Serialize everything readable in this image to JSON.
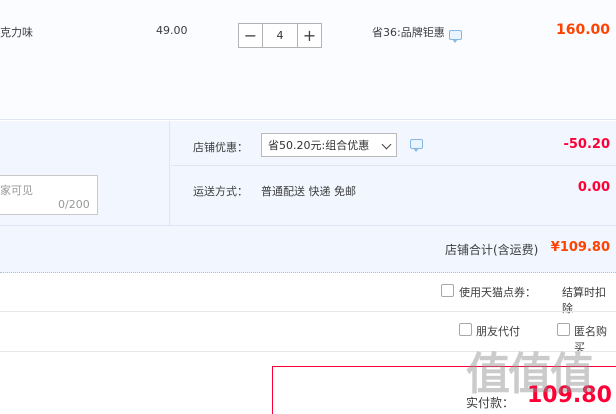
{
  "product": {
    "name": "克力味",
    "unit_price": "49.00",
    "quantity": "4",
    "decrease_label": "−",
    "increase_label": "+",
    "promotion": "省36:品牌钜惠",
    "line_total": "160.00"
  },
  "shop": {
    "discount_label": "店铺优惠：",
    "discount_selected": "省50.20元:组合优惠",
    "discount_value": "-50.20",
    "shipping_label": "运送方式：",
    "shipping_method": "普通配送 快递 免邮",
    "shipping_fee": "0.00",
    "message_placeholder": "家可见",
    "message_count": "0/200",
    "total_label": "店铺合计(含运费)",
    "total_value": "¥109.80"
  },
  "options": {
    "tmall_points_label": "使用天猫点券：",
    "checkout_deduct": "结算时扣除",
    "friend_pay_label": "朋友代付",
    "anonymous_label": "匿名购买"
  },
  "payment": {
    "label": "实付款：",
    "amount": "109.80"
  },
  "watermark": {
    "text": "值值值"
  },
  "colors": {
    "price_orange": "#ff4200",
    "price_red": "#ff0036",
    "section_blue": "#f2f7ff"
  }
}
